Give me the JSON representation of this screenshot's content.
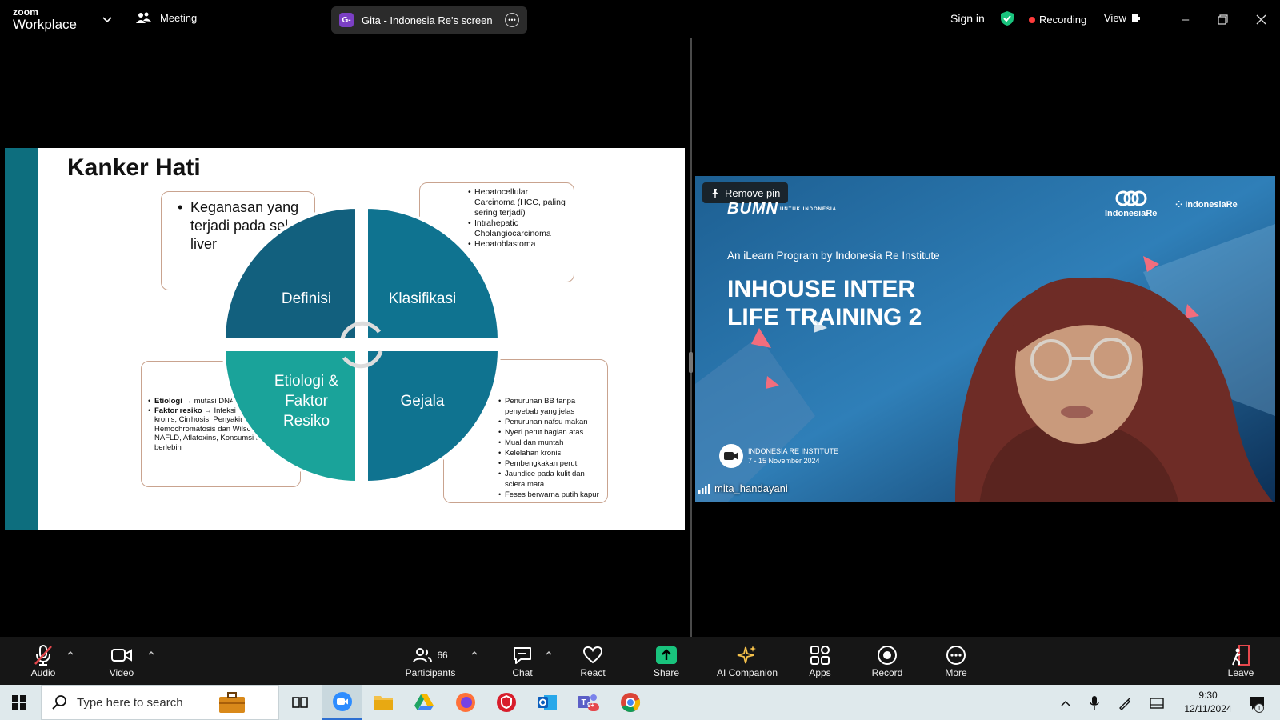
{
  "window": {
    "brand_top": "zoom",
    "brand_bottom": "Workplace",
    "meeting_label": "Meeting",
    "share_avatar": "G-",
    "share_label": "Gita - Indonesia Re's screen",
    "signin": "Sign in",
    "recording": "Recording",
    "view": "View",
    "colors": {
      "accent_green": "#19c37d",
      "record_red": "#ff3b3b",
      "slide_teal": "#0d6e7e"
    }
  },
  "slide": {
    "title": "Kanker Hati",
    "definition_box": [
      "Keganasan yang terjadi pada sel liver"
    ],
    "quadrants": {
      "top_left": "Definisi",
      "top_right": "Klasifikasi",
      "bottom_left_1": "Etiologi &",
      "bottom_left_2": "Faktor",
      "bottom_left_3": "Resiko",
      "bottom_right": "Gejala"
    },
    "klasifikasi_box": [
      "Hepatocellular Carcinoma (HCC, paling sering terjadi)",
      "Intrahepatic Cholangiocarcinoma",
      "Hepatoblastoma"
    ],
    "etiologi_box": {
      "etiologi_label": "Etiologi",
      "etiologi_text": "mutasi DNA",
      "faktor_label": "Faktor resiko",
      "faktor_text": "Infeksi HBV atau HCV kronis, Cirrhosis, Penyakit genetik (e.g. Hemochromatosis dan Wilson's Disease), NAFLD, Aflatoxins, Konsumsi alkohol berlebih",
      "arrow": "→"
    },
    "gejala_box": [
      "Penurunan BB tanpa penyebab yang jelas",
      "Penurunan nafsu makan",
      "Nyeri perut bagian atas",
      "Mual dan muntah",
      "Kelelahan kronis",
      "Pembengkakan perut",
      "Jaundice pada kulit dan sclera mata",
      "Feses berwarna putih kapur"
    ]
  },
  "video": {
    "remove_pin": "Remove pin",
    "bumn": "BUMN",
    "bumn_sub": "UNTUK INDONESIA",
    "ire_logo": "IndonesiaRe",
    "iri_logo": "IndonesiaRe",
    "program": "An iLearn Program by Indonesia Re Institute",
    "headline_1": "INHOUSE INTER",
    "headline_2": "LIFE TRAINING 2",
    "event_org": "INDONESIA RE INSTITUTE",
    "event_date": "7 - 15 November 2024",
    "participant_name": "mita_handayani"
  },
  "toolbar": {
    "audio": "Audio",
    "video": "Video",
    "participants": "Participants",
    "participants_count": "66",
    "chat": "Chat",
    "react": "React",
    "share": "Share",
    "ai_companion": "AI Companion",
    "apps": "Apps",
    "record": "Record",
    "more": "More",
    "leave": "Leave"
  },
  "taskbar": {
    "search_placeholder": "Type here to search",
    "time": "9:30",
    "date": "12/11/2024",
    "teams_badge": "9+",
    "notif_count": "1"
  }
}
